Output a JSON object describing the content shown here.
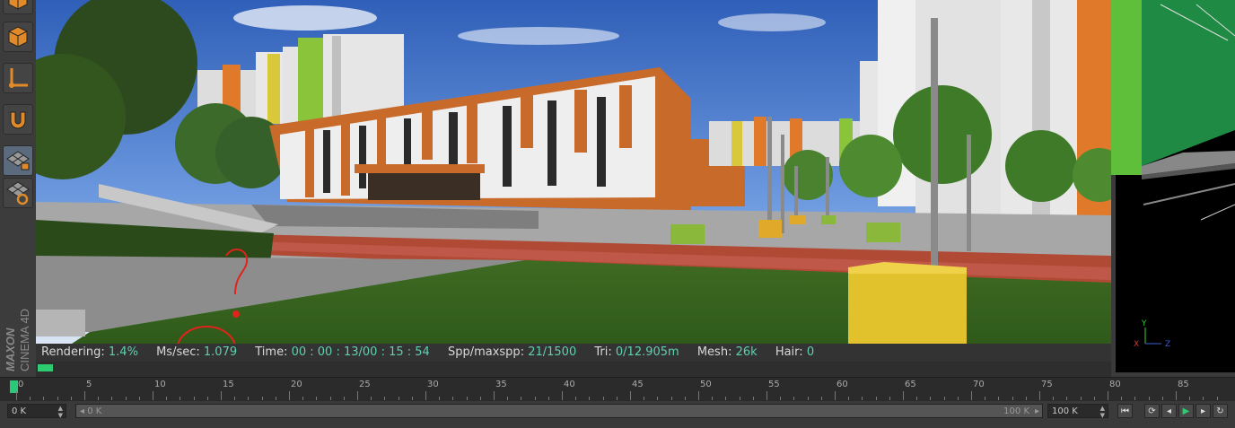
{
  "brand": {
    "line1": "MAXON",
    "line2": "CINEMA 4D"
  },
  "toolbar": {
    "icons": [
      "cube-icon",
      "cube-icon",
      "axis-icon",
      "magnet-icon",
      "grid-lock-icon",
      "grid-rotate-icon"
    ]
  },
  "status": {
    "rendering_label": "Rendering:",
    "rendering_value": "1.4%",
    "mssec_label": "Ms/sec:",
    "mssec_value": "1.079",
    "time_label": "Time:",
    "time_value": "00 : 00 : 13/00 : 15 : 54",
    "spp_label": "Spp/maxspp:",
    "spp_value": "21/1500",
    "tri_label": "Tri:",
    "tri_value": "0/12.905m",
    "mesh_label": "Mesh:",
    "mesh_value": "26k",
    "hair_label": "Hair:",
    "hair_value": "0",
    "progress": 0.014
  },
  "annotation": {
    "mark": "?"
  },
  "side_view": {
    "axis_y": "Y",
    "axis_x": "X",
    "axis_z": "Z"
  },
  "timeline": {
    "ticks": [
      "0",
      "5",
      "10",
      "15",
      "20",
      "25",
      "30",
      "35",
      "40",
      "45",
      "50",
      "55",
      "60",
      "65",
      "70",
      "75",
      "80",
      "85"
    ],
    "current_frame": 0
  },
  "range": {
    "start_field": "0 K",
    "slider_start": "0 K",
    "slider_end": "100 K",
    "end_field": "100 K"
  },
  "colors": {
    "accent": "#5fd0b0",
    "play": "#2ecc71",
    "annotation": "#e0241b"
  }
}
